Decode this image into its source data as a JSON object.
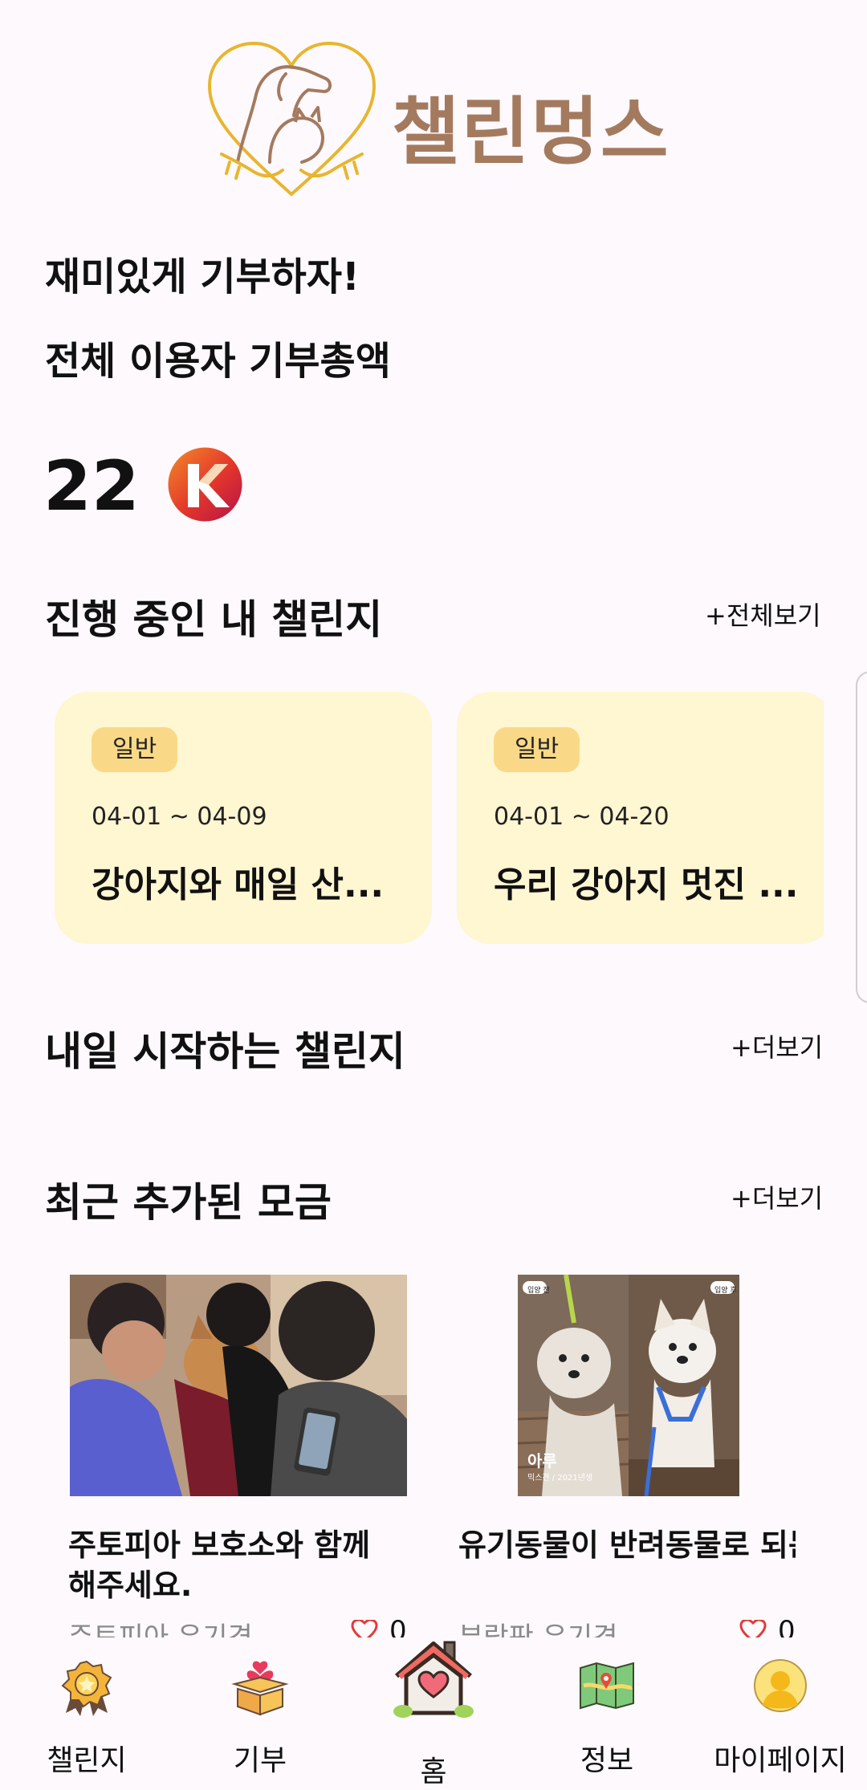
{
  "header": {
    "app_name": "챌린멍스"
  },
  "intro": {
    "tagline": "재미있게 기부하자!",
    "total_label": "전체 이용자 기부총액",
    "total_value": "22"
  },
  "my_challenges": {
    "title": "진행 중인 내 챌린지",
    "more_label": "+전체보기",
    "cards": [
      {
        "badge": "일반",
        "dates": "04-01 ~ 04-09",
        "title": "강아지와 매일 산..."
      },
      {
        "badge": "일반",
        "dates": "04-01 ~ 04-20",
        "title": "우리 강아지 멋진 ..."
      }
    ]
  },
  "tomorrow": {
    "title": "내일 시작하는 챌린지",
    "more_label": "+더보기"
  },
  "fundraising": {
    "title": "최근 추가된 모금",
    "more_label": "+더보기",
    "items": [
      {
        "title": "주토피아 보호소와 함께해주세요.",
        "org": "주토피아 유기견...",
        "likes": "0"
      },
      {
        "title": "유기동물이 반려동물로 되는 순간, 모두의행동...",
        "org": "부랑판 유기견...",
        "likes": "0"
      }
    ],
    "photo2_labels": {
      "before": "입양 전",
      "after": "입양 후",
      "name": "아루",
      "detail": "믹스견 / 2021년생"
    }
  },
  "nav": {
    "items": [
      {
        "label": "챌린지",
        "icon": "medal-icon"
      },
      {
        "label": "기부",
        "icon": "gift-box-icon"
      },
      {
        "label": "홈",
        "icon": "house-heart-icon"
      },
      {
        "label": "정보",
        "icon": "map-icon"
      },
      {
        "label": "마이페이지",
        "icon": "avatar-icon"
      }
    ]
  },
  "colors": {
    "background": "#fdf9fc",
    "brand": "#a47a5f",
    "logo_gold": "#e8b52f",
    "card_bg": "#fff6d2",
    "badge_bg": "#f9d987"
  }
}
